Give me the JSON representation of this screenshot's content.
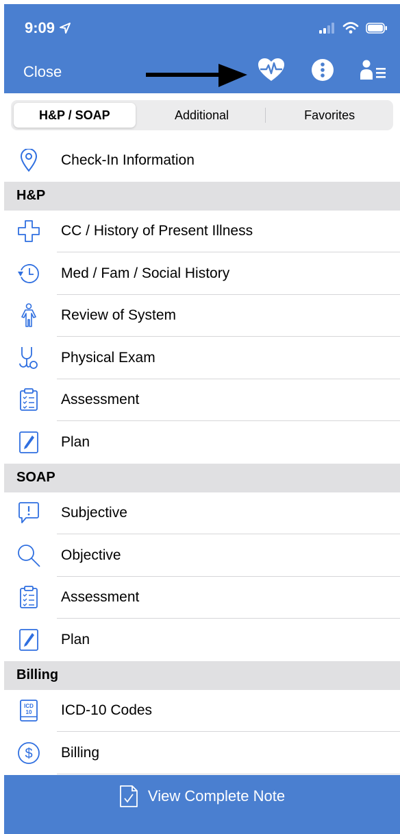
{
  "status_bar": {
    "time": "9:09"
  },
  "nav": {
    "close_label": "Close"
  },
  "tabs": [
    {
      "label": "H&P / SOAP",
      "active": true
    },
    {
      "label": "Additional",
      "active": false
    },
    {
      "label": "Favorites",
      "active": false
    }
  ],
  "list": {
    "checkin": {
      "label": "Check-In Information",
      "icon": "location-pin-icon"
    },
    "hp_header": "H&P",
    "hp_items": [
      {
        "label": "CC / History of Present Illness",
        "icon": "medical-cross-icon"
      },
      {
        "label": "Med / Fam / Social History",
        "icon": "history-clock-icon"
      },
      {
        "label": "Review of System",
        "icon": "body-figure-icon"
      },
      {
        "label": "Physical Exam",
        "icon": "stethoscope-icon"
      },
      {
        "label": "Assessment",
        "icon": "clipboard-checklist-icon"
      },
      {
        "label": "Plan",
        "icon": "pen-icon"
      }
    ],
    "soap_header": "SOAP",
    "soap_items": [
      {
        "label": "Subjective",
        "icon": "speech-exclamation-icon"
      },
      {
        "label": "Objective",
        "icon": "magnifier-icon"
      },
      {
        "label": "Assessment",
        "icon": "clipboard-checklist-icon"
      },
      {
        "label": "Plan",
        "icon": "pen-icon"
      }
    ],
    "billing_header": "Billing",
    "billing_items": [
      {
        "label": "ICD-10 Codes",
        "icon": "icd10-book-icon",
        "badge_top": "ICD",
        "badge_bottom": "10"
      },
      {
        "label": "Billing",
        "icon": "dollar-circle-icon"
      }
    ]
  },
  "footer": {
    "label": "View Complete Note"
  },
  "colors": {
    "brand_blue": "#4a7fd0",
    "icon_blue": "#2f6fe0"
  }
}
